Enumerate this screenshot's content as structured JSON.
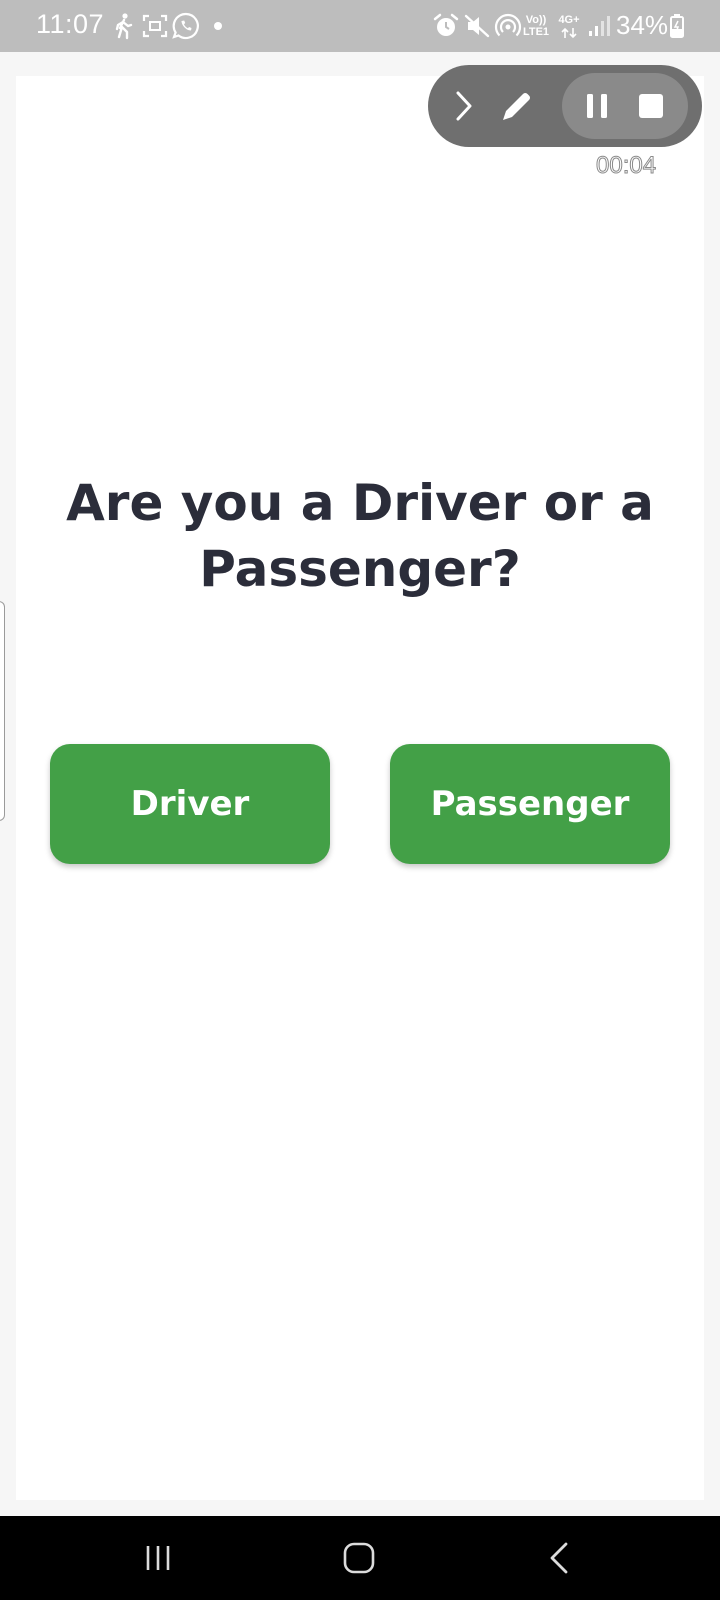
{
  "status_bar": {
    "time": "11:07",
    "battery": "34%",
    "network_top": "Vo))",
    "network_bottom": "LTE1",
    "network_type": "4G+",
    "icons": [
      "walking-icon",
      "screenshot-icon",
      "whatsapp-icon",
      "notification-dot-icon",
      "alarm-icon",
      "mute-icon",
      "hotspot-icon",
      "signal-icon",
      "battery-icon"
    ]
  },
  "recorder": {
    "timer": "00:04",
    "icons": [
      "expand-chevron-icon",
      "pencil-icon",
      "pause-icon",
      "stop-icon"
    ]
  },
  "main": {
    "question": "Are you a Driver or a Passenger?",
    "driver_label": "Driver",
    "passenger_label": "Passenger"
  },
  "nav_bar": {
    "icons": [
      "recent-apps-icon",
      "home-icon",
      "back-icon"
    ]
  },
  "colors": {
    "accent": "#43a047",
    "text": "#2b2d3a",
    "status_bar": "#bdbdbd",
    "nav_bar": "#000000"
  }
}
